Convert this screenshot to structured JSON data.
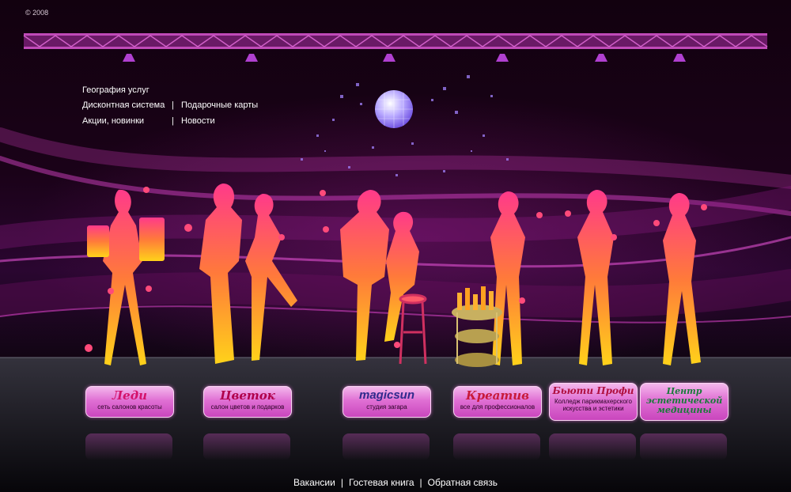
{
  "copyright": "© 2008",
  "nav": {
    "geography": "География услуг",
    "discount": "Дисконтная система",
    "gift_cards": "Подарочные карты",
    "promos": "Акции, новинки",
    "news": "Новости",
    "separator": "|"
  },
  "buttons": [
    {
      "logo": "Леди",
      "caption": "сеть салонов красоты",
      "logo_color": "#d4126a"
    },
    {
      "logo": "Цветок",
      "caption": "салон цветов и подарков",
      "logo_color": "#b0004a"
    },
    {
      "logo": "magicsun",
      "caption": "студия загара",
      "logo_color": "#2f2a8c"
    },
    {
      "logo": "Креатив",
      "caption": "все для профессионалов",
      "logo_color": "#c81a3a"
    },
    {
      "logo": "Бьюти Профи",
      "caption": "Колледж парикмахерского искусства и эстетики",
      "logo_color": "#b01040"
    },
    {
      "logo": "Центр эстетической медицины",
      "caption": "",
      "logo_color": "#1a7a3a"
    }
  ],
  "footer": {
    "jobs": "Вакансии",
    "guestbook": "Гостевая книга",
    "feedback": "Обратная связь",
    "separator": "|"
  },
  "colors": {
    "accent": "#c946bd",
    "silhouette_top": "#ff3a78",
    "silhouette_bottom": "#ffd21a",
    "truss": "#a02a9a"
  }
}
